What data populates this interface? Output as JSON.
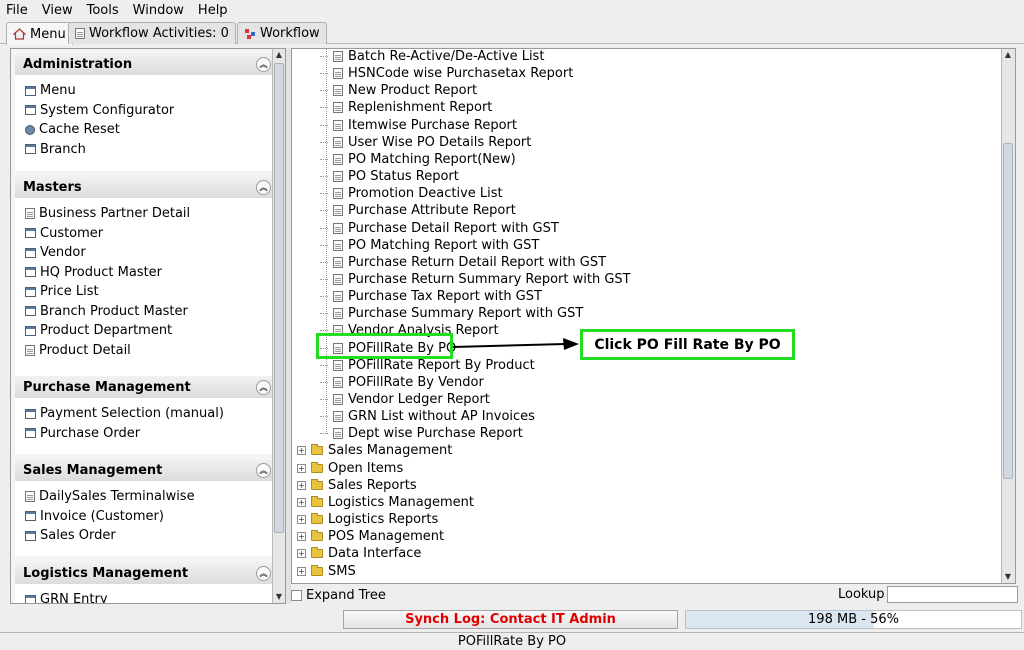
{
  "menubar": {
    "items": [
      "File",
      "View",
      "Tools",
      "Window",
      "Help"
    ]
  },
  "tabs": [
    {
      "label": "Menu",
      "icon": "home-icon"
    },
    {
      "label": "Workflow Activities: 0",
      "icon": "document-icon"
    },
    {
      "label": "Workflow",
      "icon": "workflow-icon"
    }
  ],
  "sidebar": {
    "panels": [
      {
        "title": "Administration",
        "items": [
          {
            "label": "Menu",
            "icon": "window-icon"
          },
          {
            "label": "System Configurator",
            "icon": "window-icon"
          },
          {
            "label": "Cache Reset",
            "icon": "gear-icon"
          },
          {
            "label": "Branch",
            "icon": "window-icon"
          }
        ]
      },
      {
        "title": "Masters",
        "items": [
          {
            "label": "Business Partner Detail",
            "icon": "document-icon"
          },
          {
            "label": "Customer",
            "icon": "window-icon"
          },
          {
            "label": "Vendor",
            "icon": "window-icon"
          },
          {
            "label": "HQ Product Master",
            "icon": "window-icon"
          },
          {
            "label": "Price List",
            "icon": "window-icon"
          },
          {
            "label": "Branch Product Master",
            "icon": "window-icon"
          },
          {
            "label": "Product Department",
            "icon": "window-icon"
          },
          {
            "label": "Product Detail",
            "icon": "document-icon"
          }
        ]
      },
      {
        "title": "Purchase Management",
        "items": [
          {
            "label": "Payment Selection (manual)",
            "icon": "window-icon"
          },
          {
            "label": "Purchase Order",
            "icon": "window-icon"
          }
        ]
      },
      {
        "title": "Sales Management",
        "items": [
          {
            "label": "DailySales Terminalwise",
            "icon": "document-icon"
          },
          {
            "label": "Invoice (Customer)",
            "icon": "window-icon"
          },
          {
            "label": "Sales Order",
            "icon": "window-icon"
          }
        ]
      },
      {
        "title": "Logistics Management",
        "items": [
          {
            "label": "GRN Entry",
            "icon": "window-icon"
          }
        ]
      }
    ]
  },
  "tree": {
    "reports": [
      "Batch Re-Active/De-Active List",
      "HSNCode wise Purchasetax Report",
      "New Product Report",
      "Replenishment Report",
      "Itemwise Purchase Report",
      "User Wise PO Details Report",
      "PO Matching Report(New)",
      "PO Status Report",
      "Promotion Deactive List",
      "Purchase Attribute Report",
      "Purchase Detail Report with GST",
      "PO Matching Report with GST",
      "Purchase Return Detail Report with GST",
      "Purchase Return Summary Report with GST",
      "Purchase Tax Report with GST",
      "Purchase Summary Report with GST",
      "Vendor Analysis Report",
      "POFillRate By PO",
      "POFillRate Report By Product",
      "POFillRate By Vendor",
      "Vendor Ledger Report",
      "GRN List without AP Invoices",
      "Dept wise Purchase Report"
    ],
    "folders": [
      "Sales Management",
      "Open Items",
      "Sales Reports",
      "Logistics Management",
      "Logistics Reports",
      "POS Management",
      "Data Interface",
      "SMS"
    ],
    "selected": "POFillRate By PO"
  },
  "annotation": {
    "text": "Click PO Fill Rate By PO",
    "color": "#22dd22"
  },
  "bottom": {
    "expand_tree_label": "Expand Tree",
    "lookup_label": "Lookup",
    "lookup_value": ""
  },
  "status": {
    "synch_log": "Synch Log: Contact IT Admin",
    "memory_text": "198 MB - 56%",
    "memory_percent": 56,
    "statusbar_text": "POFillRate By PO"
  }
}
